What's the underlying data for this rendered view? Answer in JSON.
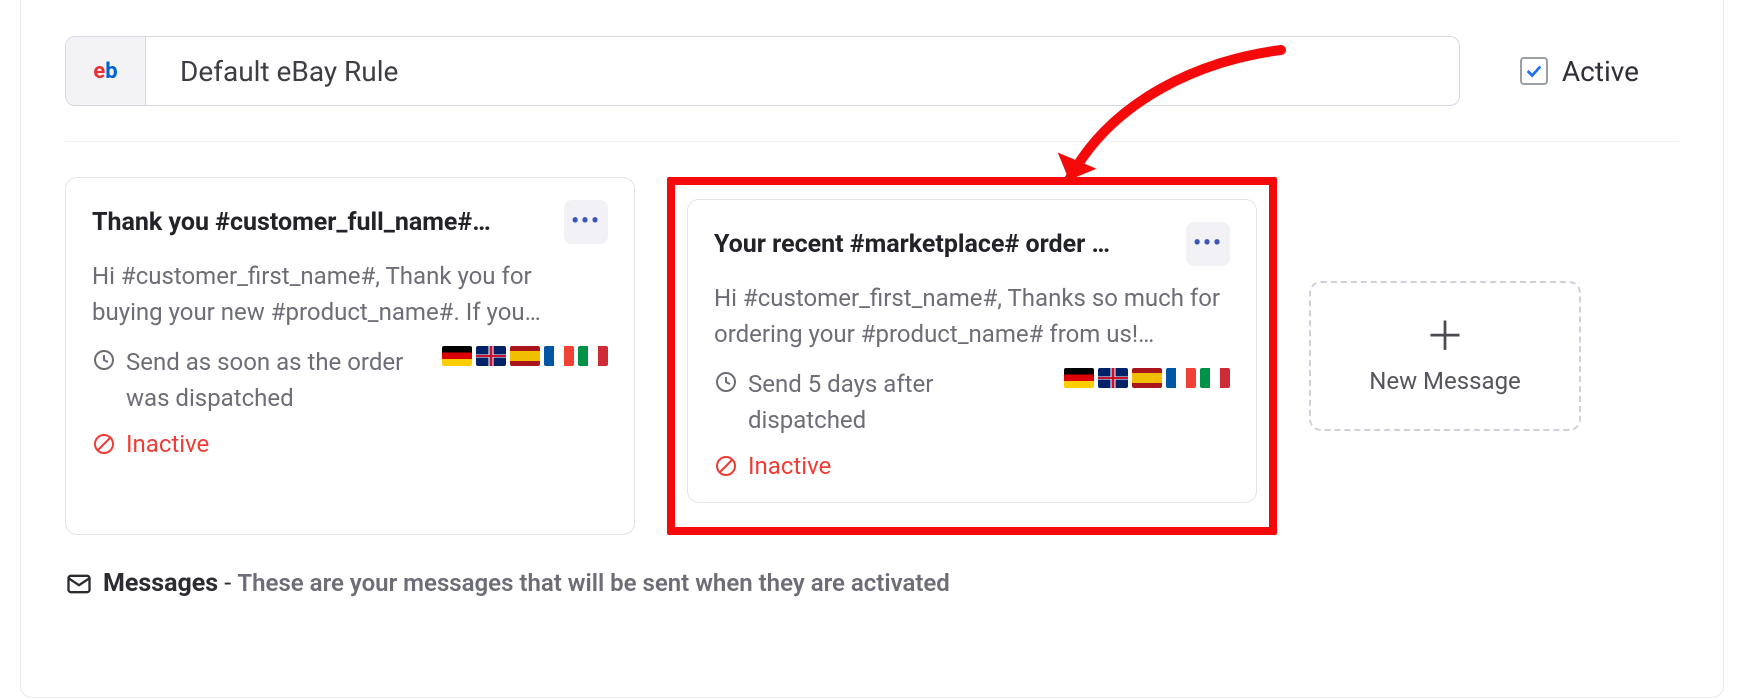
{
  "header": {
    "logo_prefix": "e",
    "logo_suffix": "b",
    "rule_name": "Default eBay Rule",
    "active_label": "Active",
    "active_checked": true
  },
  "cards": [
    {
      "title": "Thank you #customer_full_name#…",
      "body": "Hi #customer_first_name#, Thank you for buying your new #product_name#. If you…",
      "timing": "Send as soon as the order was dispatched",
      "status": "Inactive",
      "flags": [
        "de",
        "gb",
        "es",
        "fr",
        "it"
      ]
    },
    {
      "title": "Your recent #marketplace# order …",
      "body": "Hi #customer_first_name#, Thanks so much for ordering your #product_name# from us!…",
      "timing": "Send 5 days after dispatched",
      "status": "Inactive",
      "flags": [
        "de",
        "gb",
        "es",
        "fr",
        "it"
      ]
    }
  ],
  "new_message_label": "New Message",
  "footer": {
    "title": "Messages",
    "separator": " - ",
    "subtitle": "These are your messages that will be sent when they are activated"
  }
}
